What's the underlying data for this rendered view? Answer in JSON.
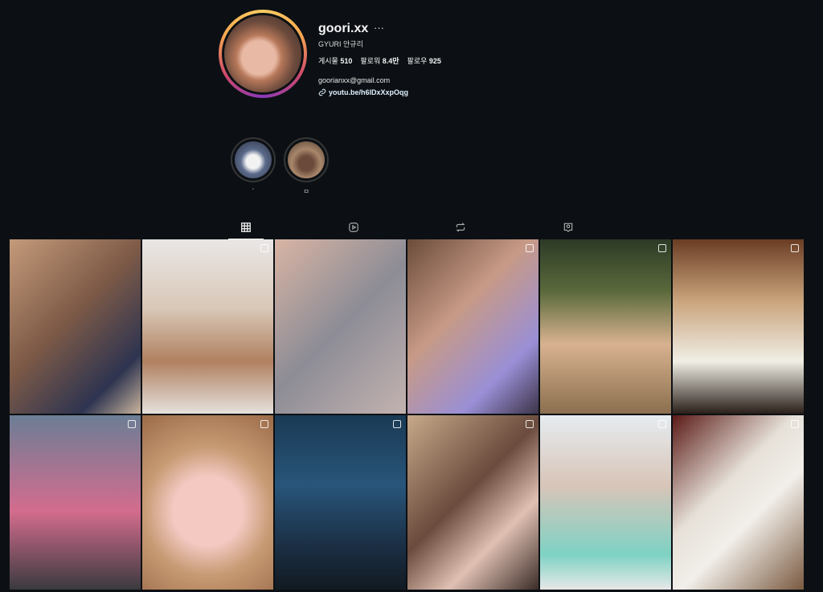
{
  "profile": {
    "username": "goori.xx",
    "more_icon": "more-horizontal-icon",
    "full_name": "GYURI 안규리",
    "stats": [
      {
        "label": "게시물",
        "value": "510"
      },
      {
        "label": "팔로워",
        "value": "8.4만"
      },
      {
        "label": "팔로우",
        "value": "925"
      }
    ],
    "email": "goorianxx@gmail.com",
    "link": "youtu.be/h6lDxXxpOqg"
  },
  "highlights": [
    {
      "label": "ʻ",
      "color": "#5b6a8a"
    },
    {
      "label": "ㅁ",
      "color": "#8a6a55"
    }
  ],
  "tabs": [
    {
      "icon": "grid-icon",
      "active": true
    },
    {
      "icon": "reels-icon",
      "active": false
    },
    {
      "icon": "repost-icon",
      "active": false
    },
    {
      "icon": "tagged-icon",
      "active": false
    }
  ],
  "posts": [
    {
      "bg": "linear-gradient(135deg,#c49a7a,#7d5a47 45%,#2e3450 80%,#c8b49c)"
    },
    {
      "bg": "linear-gradient(180deg,#e9e7e6,#d9c7b7 40%,#b08060 70%,#e5e1dd)"
    },
    {
      "bg": "linear-gradient(135deg,#d8b4a4,#8d8c96 50%,#c3b3b0)"
    },
    {
      "bg": "linear-gradient(135deg,#6b4c3a,#c79a86 40%,#9a8fd6 75%,#3c3348)"
    },
    {
      "bg": "linear-gradient(180deg,#2c3a26,#5b6a3c 30%,#d8b290 60%,#8b6f4e)"
    },
    {
      "bg": "linear-gradient(180deg,#6a3d24,#c9a37b 35%,#f0eee5 70%,#2a1f1a)"
    },
    {
      "bg": "linear-gradient(180deg,#6b7e95,#d46c8e 55%,#3a3a3e)"
    },
    {
      "bg": "radial-gradient(circle at 50% 55%,#f3c9c2 0 30%,#c79b74 55%,#9b6a48 100%)"
    },
    {
      "bg": "linear-gradient(180deg,#1a3a54,#28557a 40%,#1b2f44 75%,#111a22)"
    },
    {
      "bg": "linear-gradient(135deg,#c7a98a,#6a4b3d 45%,#e0c0b3 70%,#3a2c27)"
    },
    {
      "bg": "linear-gradient(180deg,#e6ecf0,#d8c5b8 40%,#7ed2c4 80%,#e8e8e8)"
    },
    {
      "bg": "linear-gradient(135deg,#5a1a16,#e6e0d8 40%,#f2efea 60%,#7a5a40)"
    }
  ],
  "colors": {
    "background": "#0c1014",
    "text": "#f5f5f5"
  }
}
